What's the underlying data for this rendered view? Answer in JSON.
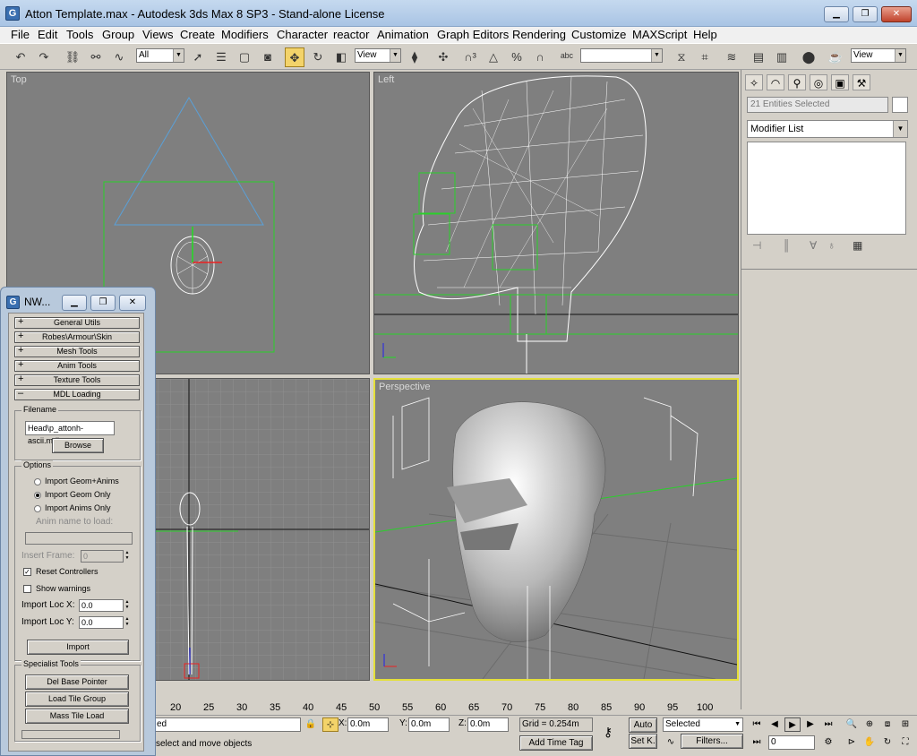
{
  "window": {
    "title": "Atton Template.max - Autodesk 3ds Max 8 SP3  - Stand-alone License",
    "icon": "G"
  },
  "menu": [
    "File",
    "Edit",
    "Tools",
    "Group",
    "Views",
    "Create",
    "Modifiers",
    "Character",
    "reactor",
    "Animation",
    "Graph Editors",
    "Rendering",
    "Customize",
    "MAXScript",
    "Help"
  ],
  "toolbar": {
    "selection_filter": "All",
    "ref_coord": "View",
    "named_selection": "",
    "viewport_select": "View"
  },
  "viewports": {
    "top": "Top",
    "left": "Left",
    "front": "",
    "perspective": "Perspective"
  },
  "command_panel": {
    "entities": "21 Entities Selected",
    "modifier_list": "Modifier List"
  },
  "nw_dialog": {
    "title": "NW...",
    "rollouts": [
      {
        "pm": "+",
        "label": "General Utils"
      },
      {
        "pm": "+",
        "label": "Robes\\Armour\\Skin"
      },
      {
        "pm": "+",
        "label": "Mesh Tools"
      },
      {
        "pm": "+",
        "label": "Anim Tools"
      },
      {
        "pm": "+",
        "label": "Texture Tools"
      },
      {
        "pm": "–",
        "label": "MDL Loading"
      }
    ],
    "filename_group": "Filename",
    "filename_value": "Head\\p_attonh-ascii.mdl",
    "browse": "Browse",
    "options_group": "Options",
    "radio_geom_anims": "Import Geom+Anims",
    "radio_geom_only": "Import Geom Only",
    "radio_anims_only": "Import Anims Only",
    "anim_name_label": "Anim name to load:",
    "anim_name_value": "",
    "insert_frame_label": "Insert Frame:",
    "insert_frame_value": "0",
    "reset_controllers": "Reset Controllers",
    "reset_controllers_mark": "✓",
    "show_warnings": "Show warnings",
    "import_loc_x_label": "Import Loc X:",
    "import_loc_x_value": "0.0",
    "import_loc_y_label": "Import Loc Y:",
    "import_loc_y_value": "0.0",
    "import": "Import",
    "specialist_group": "Specialist Tools",
    "del_base_pointer": "Del Base Pointer",
    "load_tile_group": "Load Tile Group",
    "mass_tile_load": "Mass Tile Load"
  },
  "timeline": {
    "ticks": [
      "20",
      "25",
      "30",
      "35",
      "40",
      "45",
      "50",
      "55",
      "60",
      "65",
      "70",
      "75",
      "80",
      "85",
      "90",
      "95",
      "100"
    ]
  },
  "status": {
    "selected_tail": "ed",
    "prompt": "select and move objects",
    "x_label": "X:",
    "x_value": "0.0m",
    "y_label": "Y:",
    "y_value": "0.0m",
    "z_label": "Z:",
    "z_value": "0.0m",
    "grid": "Grid = 0.254m",
    "add_time_tag": "Add Time Tag",
    "auto_key": "Auto",
    "set_key": "Set K.",
    "key_filter_sel": "Selected",
    "filters": "Filters...",
    "frame": "0"
  }
}
